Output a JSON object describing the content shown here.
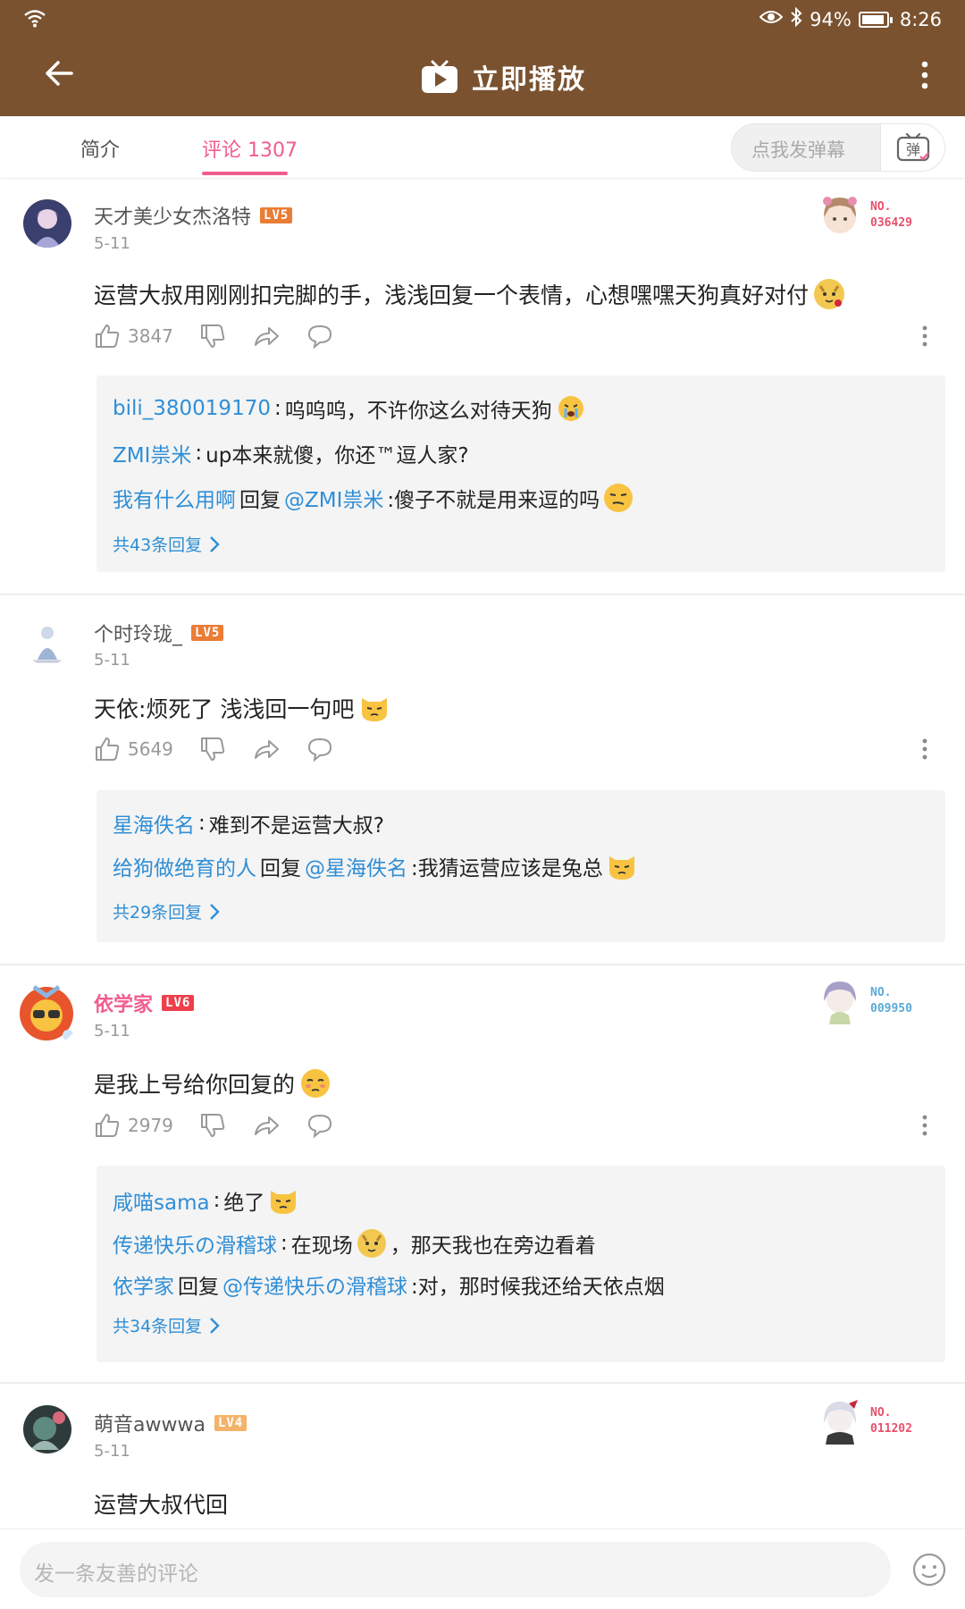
{
  "status_bar": {
    "battery": "94%",
    "battery_level": 0.94,
    "time": "8:26"
  },
  "app_bar": {
    "title": "立即播放"
  },
  "tabs": {
    "intro": "简介",
    "comments": "评论 1307",
    "danmaku_placeholder": "点我发弹幕",
    "danmaku_button": "弹"
  },
  "comments": [
    {
      "username": "天才美少女杰洛特",
      "level": "LV5",
      "date": "5-11",
      "fan_no": "NO.",
      "fan_num": "036429",
      "text": "运营大叔用刚刚扣完脚的手，浅浅回复一个表情，心想嘿嘿天狗真好对付",
      "likes": "3847",
      "replies": [
        {
          "user": "bili_380019170",
          "sep": ": ",
          "text": "呜呜呜，不许你这么对待天狗"
        },
        {
          "user": "ZMI祟米",
          "sep": ": ",
          "text": "up本来就傻，你还™逗人家?"
        },
        {
          "user": "我有什么用啊",
          "mid": " 回复 ",
          "target": "@ZMI祟米",
          "text": " :傻子不就是用来逗的吗"
        }
      ],
      "more": "共43条回复"
    },
    {
      "username": "个时玲珑_",
      "level": "LV5",
      "date": "5-11",
      "text": "天依:烦死了 浅浅回一句吧",
      "likes": "5649",
      "replies": [
        {
          "user": "星海佚名",
          "sep": ": ",
          "text": "难到不是运营大叔?"
        },
        {
          "user": "给狗做绝育的人",
          "mid": " 回复 ",
          "target": "@星海佚名",
          "text": " :我猜运营应该是兔总"
        }
      ],
      "more": "共29条回复"
    },
    {
      "username": "依学家",
      "level": "LV6",
      "date": "5-11",
      "fan_no": "NO.",
      "fan_num": "009950",
      "text": "是我上号给你回复的",
      "likes": "2979",
      "replies": [
        {
          "user": "咸喵sama",
          "sep": ": ",
          "text": "绝了"
        },
        {
          "user": "传递快乐の滑稽球",
          "sep": ": ",
          "text": "在现场",
          "text2": "，那天我也在旁边看着"
        },
        {
          "user": "依学家",
          "mid": " 回复 ",
          "target": "@传递快乐の滑稽球",
          "text": " :对，那时候我还给天依点烟"
        }
      ],
      "more": "共34条回复"
    },
    {
      "username": "萌音awwwa",
      "level": "LV4",
      "date": "5-11",
      "fan_no": "NO.",
      "fan_num": "011202",
      "text": "运营大叔代回"
    }
  ],
  "bottom": {
    "placeholder": "发一条友善的评论"
  },
  "colors": {
    "header": "#7a5230",
    "accent": "#f25d8e",
    "link": "#2f8ed6",
    "reply_bg": "#f4f4f4"
  }
}
